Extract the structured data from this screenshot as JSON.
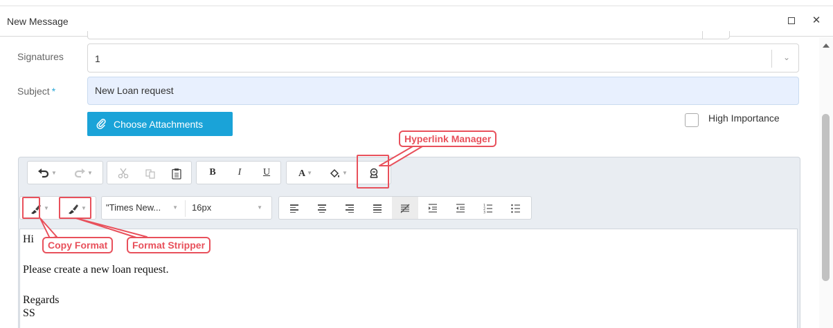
{
  "window": {
    "title": "New Message",
    "maximize_icon": "maximize-icon",
    "close_icon": "close-icon",
    "close_glyph": "✕"
  },
  "form": {
    "signatures_label": "Signatures",
    "signatures_value": "1",
    "subject_label": "Subject",
    "subject_required": "*",
    "subject_value": "New Loan request",
    "attach_button": "Choose Attachments",
    "high_importance_label": "High Importance"
  },
  "toolbar": {
    "font_name": "\"Times New...",
    "font_size": "16px",
    "bold": "B",
    "italic": "I",
    "underline": "U",
    "font_color": "A",
    "icons": [
      "undo-icon",
      "redo-icon",
      "cut-icon",
      "copy-icon",
      "paste-icon",
      "bold-icon",
      "italic-icon",
      "underline-icon",
      "font-color-icon",
      "background-color-icon",
      "hyperlink-manager-icon",
      "copy-format-icon",
      "format-stripper-icon",
      "align-left-icon",
      "align-center-icon",
      "align-right-icon",
      "justify-icon",
      "justify-none-icon",
      "indent-icon",
      "outdent-icon",
      "numbered-list-icon",
      "bulleted-list-icon"
    ]
  },
  "body": {
    "line1": "Hi",
    "line2": "Please create a new loan request.",
    "line3": "Regards",
    "line4": "SS"
  },
  "annotations": {
    "hyperlink_manager": "Hyperlink Manager",
    "copy_format": "Copy Format",
    "format_stripper": "Format Stripper"
  },
  "colors": {
    "accent": "#1aa3d8",
    "annotation": "#e8505b",
    "subject_bg": "#e8f0fe"
  }
}
